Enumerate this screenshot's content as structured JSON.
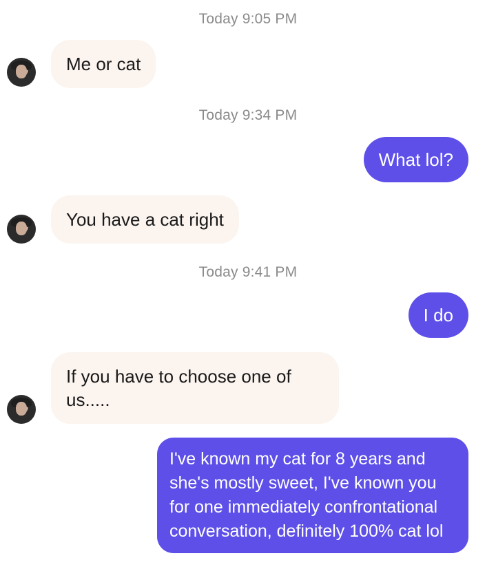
{
  "thread": {
    "timestamps": [
      "Today 9:05 PM",
      "Today 9:34 PM",
      "Today 9:41 PM"
    ],
    "messages": [
      {
        "from": "them",
        "text": "Me or cat"
      },
      {
        "from": "me",
        "text": "What lol?"
      },
      {
        "from": "them",
        "text": "You have a cat right"
      },
      {
        "from": "me",
        "text": "I do"
      },
      {
        "from": "them",
        "text": "If you have to choose one of us....."
      },
      {
        "from": "me",
        "text": "I've known my cat for 8 years and she's mostly sweet, I've known you for one immediately confrontational conversation, definitely 100% cat lol"
      }
    ]
  },
  "colors": {
    "incoming_bubble": "#fbf4ef",
    "outgoing_bubble": "#5d4fe8",
    "timestamp_text": "#8a8a8a"
  },
  "icons": {
    "contact_avatar": "contact-avatar"
  }
}
